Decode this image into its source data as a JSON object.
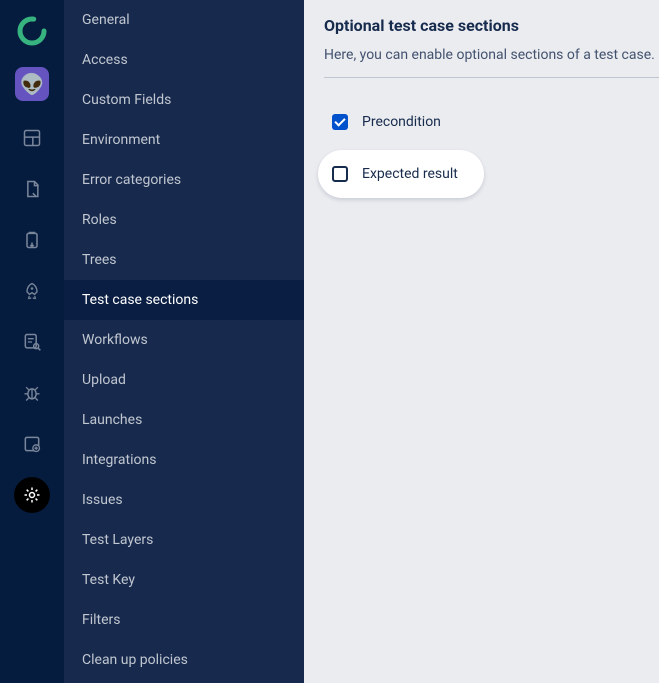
{
  "rail": {
    "items": [
      {
        "name": "dashboard-icon"
      },
      {
        "name": "document-icon"
      },
      {
        "name": "clipboard-icon"
      },
      {
        "name": "rocket-icon"
      },
      {
        "name": "search-doc-icon"
      },
      {
        "name": "bug-icon"
      },
      {
        "name": "database-icon"
      },
      {
        "name": "gear-icon",
        "active": true
      }
    ]
  },
  "sidenav": {
    "items": [
      {
        "label": "General"
      },
      {
        "label": "Access"
      },
      {
        "label": "Custom Fields"
      },
      {
        "label": "Environment"
      },
      {
        "label": "Error categories"
      },
      {
        "label": "Roles"
      },
      {
        "label": "Trees"
      },
      {
        "label": "Test case sections",
        "selected": true
      },
      {
        "label": "Workflows"
      },
      {
        "label": "Upload"
      },
      {
        "label": "Launches"
      },
      {
        "label": "Integrations"
      },
      {
        "label": "Issues"
      },
      {
        "label": "Test Layers"
      },
      {
        "label": "Test Key"
      },
      {
        "label": "Filters"
      },
      {
        "label": "Clean up policies"
      }
    ]
  },
  "main": {
    "title": "Optional test case sections",
    "desc": "Here, you can enable optional sections of a test case.",
    "options": [
      {
        "label": "Precondition",
        "checked": true,
        "highlight": false
      },
      {
        "label": "Expected result",
        "checked": false,
        "highlight": true
      }
    ]
  }
}
